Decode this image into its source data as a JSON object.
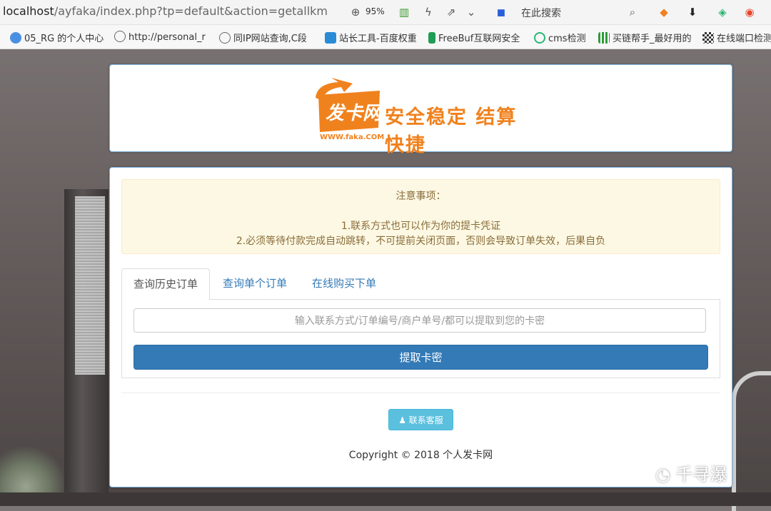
{
  "browser": {
    "url_host": "localhost",
    "url_path": "/ayfaka/index.php?tp=default&action=getallkm",
    "zoom": "95%",
    "search_placeholder": "在此搜索"
  },
  "bookmarks": [
    {
      "label": "05_RG 的个人中心",
      "icon": "globe-blue-icon"
    },
    {
      "label": "http://personal_r",
      "icon": "globe-icon"
    },
    {
      "label": "同IP网站查询,C段",
      "icon": "globe-icon"
    },
    {
      "label": "站长工具-百度权重",
      "icon": "crop-icon"
    },
    {
      "label": "FreeBuf互联网安全",
      "icon": "freebuf-icon"
    },
    {
      "label": "cms检测",
      "icon": "cms-icon"
    },
    {
      "label": "买链帮手_最好用的",
      "icon": "grid-icon"
    },
    {
      "label": "在线端口检测",
      "icon": "qr-icon"
    }
  ],
  "logo": {
    "brand": "发卡网",
    "domain_text": "WWW.faka.COM",
    "slogan": "安全稳定 结算快捷",
    "brand_color": "#f0821e"
  },
  "notice": {
    "title": "注意事项：",
    "line1": "1.联系方式也可以作为你的提卡凭证",
    "line2": "2.必须等待付款完成自动跳转，不可提前关闭页面，否则会导致订单失效，后果自负"
  },
  "tabs": [
    {
      "label": "查询历史订单",
      "active": true
    },
    {
      "label": "查询单个订单",
      "active": false
    },
    {
      "label": "在线购买下单",
      "active": false
    }
  ],
  "query": {
    "placeholder": "输入联系方式/订单编号/商户单号/都可以提取到您的卡密",
    "button_label": "提取卡密"
  },
  "service_button": "联系客服",
  "copyright": "Copyright © 2018 个人发卡网",
  "watermark": "千寻瀑",
  "colors": {
    "primary": "#337ab7",
    "info": "#5bc0de",
    "notice_bg": "#fcf8e3",
    "notice_text": "#8a6d3b"
  }
}
